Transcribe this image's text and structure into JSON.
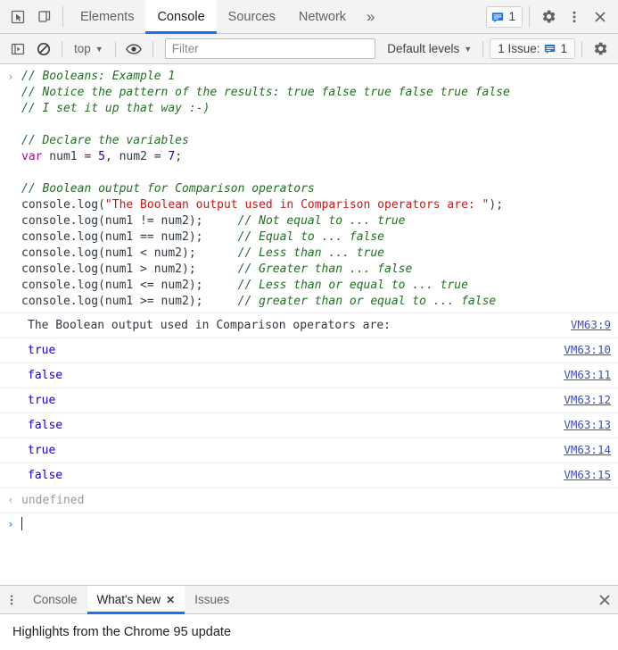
{
  "tabbar": {
    "icons": [
      {
        "name": "inspect-element-icon",
        "label": "Inspect element"
      },
      {
        "name": "device-toolbar-icon",
        "label": "Toggle device toolbar"
      }
    ],
    "tabs": [
      {
        "label": "Elements",
        "active": false
      },
      {
        "label": "Console",
        "active": true
      },
      {
        "label": "Sources",
        "active": false
      },
      {
        "label": "Network",
        "active": false
      }
    ],
    "more_label": "»",
    "issues_count": "1",
    "settings_label": "Settings",
    "menu_label": "Customize and control DevTools",
    "close_label": "Close DevTools"
  },
  "toolbar": {
    "sidebar_toggle_label": "Show console sidebar",
    "clear_console_label": "Clear console",
    "context_value": "top",
    "eye_label": "Create live expression",
    "filter_placeholder": "Filter",
    "filter_value": "",
    "levels_value": "Default levels",
    "issue_label": "1 Issue:",
    "issue_count": "1",
    "settings_label": "Console settings"
  },
  "console": {
    "prompt_arrow": "›",
    "input_lines": [
      [
        {
          "t": "comment",
          "v": "// Booleans: Example 1"
        }
      ],
      [
        {
          "t": "comment",
          "v": "// Notice the pattern of the results: true false true false true false"
        }
      ],
      [
        {
          "t": "comment",
          "v": "// I set it up that way :-)"
        }
      ],
      [
        {
          "t": "plain",
          "v": ""
        }
      ],
      [
        {
          "t": "comment",
          "v": "// Declare the variables"
        }
      ],
      [
        {
          "t": "keyword",
          "v": "var"
        },
        {
          "t": "plain",
          "v": " num1 = "
        },
        {
          "t": "number",
          "v": "5"
        },
        {
          "t": "plain",
          "v": ", num2 = "
        },
        {
          "t": "number",
          "v": "7"
        },
        {
          "t": "plain",
          "v": ";"
        }
      ],
      [
        {
          "t": "plain",
          "v": ""
        }
      ],
      [
        {
          "t": "comment",
          "v": "// Boolean output for Comparison operators"
        }
      ],
      [
        {
          "t": "plain",
          "v": "console.log("
        },
        {
          "t": "string",
          "v": "\"The Boolean output used in Comparison operators are: \""
        },
        {
          "t": "plain",
          "v": ");"
        }
      ],
      [
        {
          "t": "plain",
          "v": "console.log(num1 != num2);     "
        },
        {
          "t": "comment",
          "v": "// Not equal to ... true"
        }
      ],
      [
        {
          "t": "plain",
          "v": "console.log(num1 == num2);     "
        },
        {
          "t": "comment",
          "v": "// Equal to ... false"
        }
      ],
      [
        {
          "t": "plain",
          "v": "console.log(num1 < num2);      "
        },
        {
          "t": "comment",
          "v": "// Less than ... true"
        }
      ],
      [
        {
          "t": "plain",
          "v": "console.log(num1 > num2);      "
        },
        {
          "t": "comment",
          "v": "// Greater than ... false"
        }
      ],
      [
        {
          "t": "plain",
          "v": "console.log(num1 <= num2);     "
        },
        {
          "t": "comment",
          "v": "// Less than or equal to ... true"
        }
      ],
      [
        {
          "t": "plain",
          "v": "console.log(num1 >= num2);     "
        },
        {
          "t": "comment",
          "v": "// greater than or equal to ... false"
        }
      ]
    ],
    "output_rows": [
      {
        "text": "The Boolean output used in Comparison operators are:",
        "kind": "text",
        "source": "VM63:9"
      },
      {
        "text": "true",
        "kind": "boolean",
        "source": "VM63:10"
      },
      {
        "text": "false",
        "kind": "boolean",
        "source": "VM63:11"
      },
      {
        "text": "true",
        "kind": "boolean",
        "source": "VM63:12"
      },
      {
        "text": "false",
        "kind": "boolean",
        "source": "VM63:13"
      },
      {
        "text": "true",
        "kind": "boolean",
        "source": "VM63:14"
      },
      {
        "text": "false",
        "kind": "boolean",
        "source": "VM63:15"
      }
    ],
    "result": {
      "arrow": "‹",
      "value": "undefined"
    }
  },
  "drawer": {
    "menu_label": "More tools",
    "tabs": [
      {
        "label": "Console",
        "active": false,
        "closable": false
      },
      {
        "label": "What's New",
        "active": true,
        "closable": true
      },
      {
        "label": "Issues",
        "active": false,
        "closable": false
      }
    ],
    "close_label": "Close drawer",
    "heading": "Highlights from the Chrome 95 update"
  },
  "colors": {
    "accent": "#1a73e8",
    "toolbar_bg": "#f3f3f3",
    "comment": "#236e25",
    "keyword": "#aa0d91",
    "number": "#1c00cf",
    "string": "#c41a16",
    "link": "#3f4ebf"
  }
}
